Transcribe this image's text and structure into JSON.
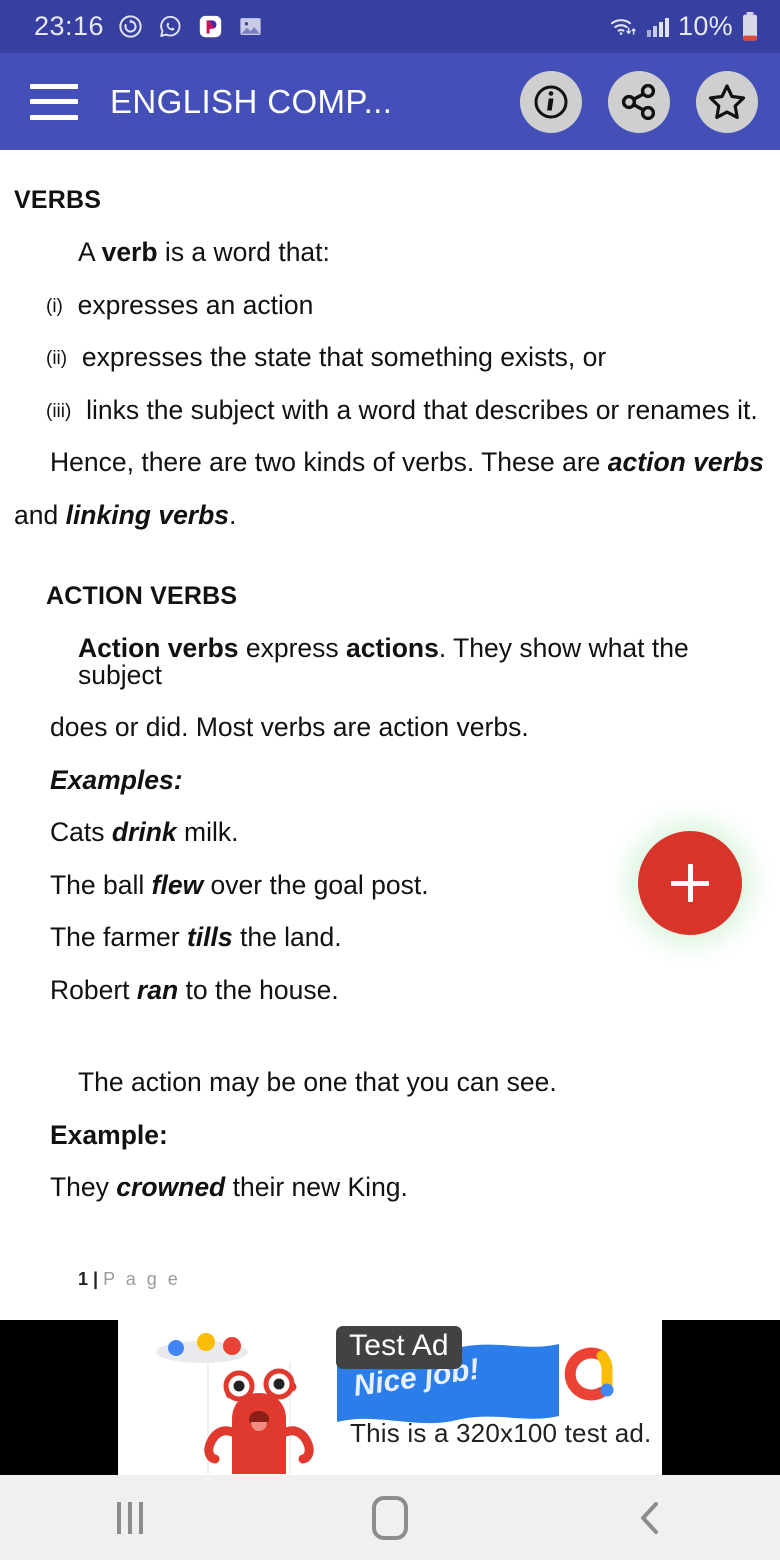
{
  "status_bar": {
    "time": "23:16",
    "icons": [
      "refresh-circle-icon",
      "whatsapp-icon",
      "picsart-icon",
      "gallery-icon"
    ],
    "wifi": "wifi-icon",
    "signal": "signal-bars-icon",
    "battery_percent": "10%",
    "battery_icon": "battery-low-icon",
    "background_color": "#3740a0"
  },
  "app_bar": {
    "menu_icon": "hamburger-menu-icon",
    "title": "ENGLISH COMP...",
    "info_icon": "info-icon",
    "share_icon": "share-icon",
    "favorite_icon": "star-icon",
    "background_color": "#4450b8"
  },
  "document": {
    "heading": "VERBS",
    "intro": {
      "prefix": "A ",
      "bold": "verb",
      "suffix": " is a word that:"
    },
    "list": [
      {
        "num": "(i)",
        "text": "expresses  an action"
      },
      {
        "num": "(ii)",
        "text": "expresses the state that something exists, or"
      },
      {
        "num": "(iii)",
        "text": "links the subject with a word that describes or renames it."
      }
    ],
    "hence": {
      "line1_pre": "Hence, there are two kinds of verbs. These are ",
      "line1_em": "action verbs",
      "line2_pre": "and ",
      "line2_em": "linking verbs",
      "line2_post": "."
    },
    "action_heading": "ACTION VERBS",
    "action_para": {
      "p1": "Action verbs",
      "p2": " express ",
      "p3": "actions",
      "p4": ". They show what the subject",
      "p5": "does or did. Most verbs are action verbs."
    },
    "examples_label": "Examples:",
    "examples": [
      {
        "pre": "Cats ",
        "em": "drink",
        "post": " milk."
      },
      {
        "pre": "The ball ",
        "em": "flew",
        "post": " over the goal post."
      },
      {
        "pre": "The farmer ",
        "em": "tills",
        "post": " the land."
      },
      {
        "pre": "Robert ",
        "em": "ran",
        "post": " to the house."
      }
    ],
    "action_see": "The action may be one that you can see.",
    "example_label": "Example:",
    "example_single": {
      "pre": "They ",
      "em": "crowned",
      "post": " their new King."
    },
    "page_number": "1",
    "page_separator": "|",
    "page_word": "P a g e"
  },
  "fab": {
    "icon": "plus-icon",
    "color": "#d8352a"
  },
  "ad": {
    "badge": "Test Ad",
    "flag_text": "Nice job!",
    "body_text": "This is a 320x100 test ad.",
    "logo": "admob-logo-icon",
    "monster": "red-monster-illustration"
  },
  "nav_bar": {
    "recents": "recents-icon",
    "home": "home-icon",
    "back": "back-icon"
  }
}
